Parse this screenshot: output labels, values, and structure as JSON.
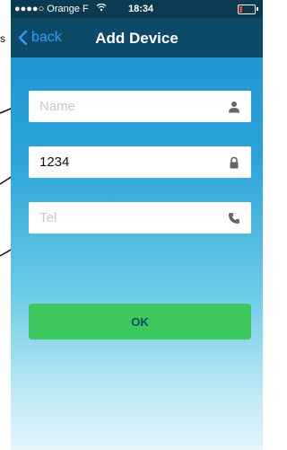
{
  "statusbar": {
    "carrier": "●●●●○ Orange F",
    "time": "18:34",
    "battery_level": 0.2,
    "battery_color": "#ff3b30"
  },
  "navbar": {
    "back_label": "back",
    "title": "Add Device"
  },
  "form": {
    "name_placeholder": "Name",
    "name_value": "",
    "code_value": "1234",
    "tel_placeholder": "Tel",
    "tel_value": "",
    "ok_label": "OK"
  },
  "colors": {
    "navbar": "#0d4a68",
    "ok_button": "#3cc85c",
    "back_link": "#2f9bff"
  },
  "icons": [
    "user-icon",
    "lock-icon",
    "phone-icon",
    "chevron-left-icon",
    "wifi-icon"
  ]
}
